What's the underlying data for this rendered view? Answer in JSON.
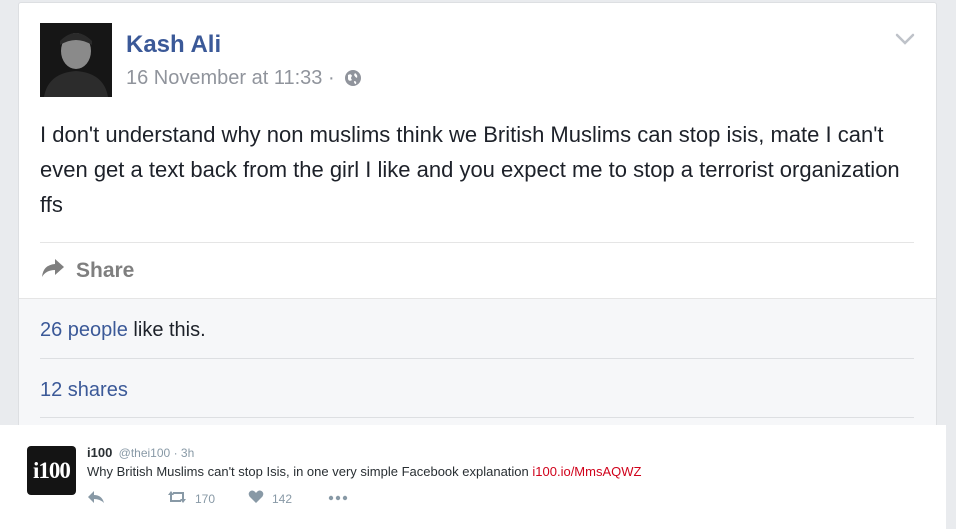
{
  "post": {
    "author": "Kash Ali",
    "timestamp": "16 November at 11:33",
    "separator": "·",
    "privacy_icon": "globe-icon",
    "text": "I don't understand why non muslims think we British Muslims can stop isis, mate I can't even get a text back from the girl I like and you expect me to stop a terrorist organization ffs",
    "share_label": "Share",
    "likes_count": "26 people",
    "likes_suffix": " like this.",
    "shares_label": "12 shares"
  },
  "tweet": {
    "avatar_text": "i100",
    "name": "i100",
    "handle": "@thei100",
    "time": "· 3h",
    "text": "Why British Muslims can't stop Isis, in one very simple Facebook explanation ",
    "link": "i100.io/MmsAQWZ",
    "retweets": "170",
    "likes": "142"
  },
  "colors": {
    "facebook_blue": "#3b5998",
    "tweet_link": "#d0021b",
    "muted": "#90949c"
  }
}
